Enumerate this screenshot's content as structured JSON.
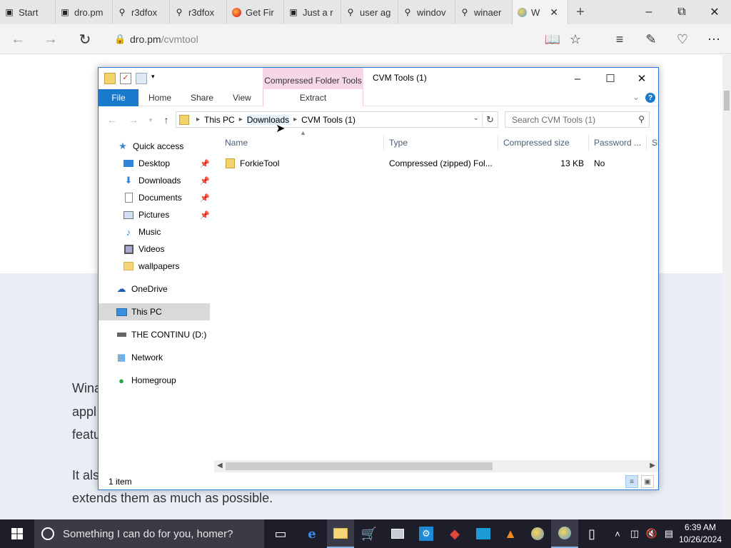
{
  "browser": {
    "tabs": [
      {
        "title": "Start",
        "icon": "start-page-icon"
      },
      {
        "title": "dro.pm",
        "icon": "page-icon"
      },
      {
        "title": "r3dfox",
        "icon": "search-icon"
      },
      {
        "title": "r3dfox",
        "icon": "search-icon"
      },
      {
        "title": "Get Fir",
        "icon": "firefox-icon"
      },
      {
        "title": "Just a r",
        "icon": "page-icon"
      },
      {
        "title": "user ag",
        "icon": "search-icon"
      },
      {
        "title": "windov",
        "icon": "search-icon"
      },
      {
        "title": "winaer",
        "icon": "search-icon"
      },
      {
        "title": "W",
        "icon": "winaero-icon"
      }
    ],
    "url_host": "dro.pm",
    "url_path": "/cvmtool"
  },
  "page": {
    "line1": "Wina",
    "line2": "appl",
    "line3": "featu",
    "line4": "It als",
    "line5": "extends them as much as possible."
  },
  "explorer": {
    "contextual_group": "Compressed Folder Tools",
    "window_title": "CVM Tools (1)",
    "ribbon_tabs": {
      "file": "File",
      "home": "Home",
      "share": "Share",
      "view": "View",
      "extract": "Extract"
    },
    "breadcrumb": [
      "This PC",
      "Downloads",
      "CVM Tools (1)"
    ],
    "search_placeholder": "Search CVM Tools (1)",
    "nav_items": [
      {
        "label": "Quick access",
        "icon": "star-icon"
      },
      {
        "label": "Desktop",
        "icon": "desktop-icon",
        "pinned": true
      },
      {
        "label": "Downloads",
        "icon": "download-icon",
        "pinned": true
      },
      {
        "label": "Documents",
        "icon": "document-icon",
        "pinned": true
      },
      {
        "label": "Pictures",
        "icon": "pictures-icon",
        "pinned": true
      },
      {
        "label": "Music",
        "icon": "music-icon"
      },
      {
        "label": "Videos",
        "icon": "video-icon"
      },
      {
        "label": "wallpapers",
        "icon": "folder-icon"
      },
      {
        "label": "OneDrive",
        "icon": "cloud-icon"
      },
      {
        "label": "This PC",
        "icon": "computer-icon",
        "selected": true
      },
      {
        "label": "THE CONTINU (D:)",
        "icon": "drive-icon"
      },
      {
        "label": "Network",
        "icon": "network-icon"
      },
      {
        "label": "Homegroup",
        "icon": "homegroup-icon"
      }
    ],
    "columns": {
      "name": "Name",
      "type": "Type",
      "size": "Compressed size",
      "password": "Password ...",
      "ratio": "Si"
    },
    "files": [
      {
        "name": "ForkieTool",
        "type": "Compressed (zipped) Fol...",
        "size": "13 KB",
        "password": "No"
      }
    ],
    "status": "1 item"
  },
  "taskbar": {
    "search_text": "Something I can do for you, homer?",
    "time": "6:39 AM",
    "date": "10/26/2024"
  },
  "colors": {
    "accent": "#1979ca",
    "context_tab": "#f6d7e8",
    "taskbar": "#1e1e2a"
  }
}
